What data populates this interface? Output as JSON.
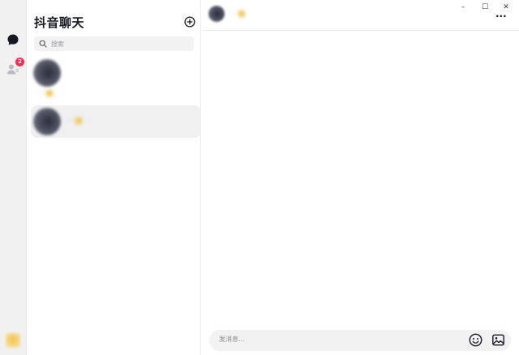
{
  "app": {
    "title": "抖音聊天"
  },
  "window_controls": {
    "minimize_label": "–",
    "maximize_label": "☐",
    "close_label": "✕"
  },
  "sidebar": {
    "items": [
      {
        "id": "chat",
        "icon": "chat-bubble-icon"
      },
      {
        "id": "contacts",
        "icon": "contacts-icon",
        "badge": "2"
      }
    ],
    "avatar_icon": "user-avatar"
  },
  "conversation_list": {
    "add_icon": "plus-circle-icon",
    "search": {
      "placeholder": "搜索",
      "value": ""
    },
    "items": [
      {
        "name": " · ·",
        "selected": false
      },
      {
        "name": " · ·",
        "selected": true
      }
    ]
  },
  "chat": {
    "header": {
      "name": " · ·",
      "more_label": "···"
    },
    "composer": {
      "placeholder": "发消息...",
      "value": "",
      "emoji_icon": "emoji-icon",
      "image_icon": "image-icon"
    }
  },
  "colors": {
    "accent_badge": "#fe2c55",
    "rail_background": "#f1f1f2",
    "selected_row": "#f0f0f1",
    "text_primary": "#161823"
  }
}
